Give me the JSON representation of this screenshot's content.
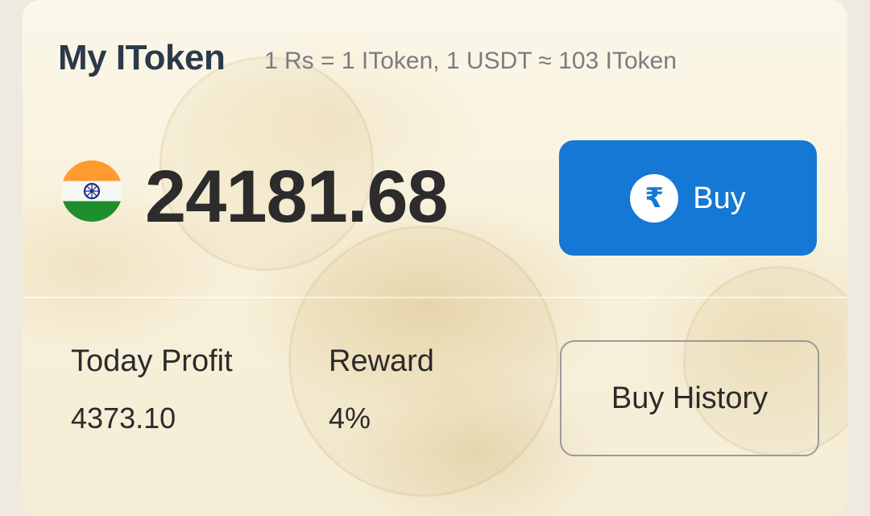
{
  "header": {
    "title": "My IToken",
    "rate": "1 Rs = 1 IToken, 1 USDT ≈ 103 IToken"
  },
  "balance": {
    "flag_icon": "india-flag-icon",
    "amount": "24181.68"
  },
  "buy_button": {
    "icon": "rupee-icon",
    "icon_glyph": "₹",
    "label": "Buy",
    "color": "#1478d4"
  },
  "stats": {
    "today_profit_label": "Today Profit",
    "today_profit_value": "4373.10",
    "reward_label": "Reward",
    "reward_value": "4%"
  },
  "history_button": {
    "label": "Buy History"
  }
}
